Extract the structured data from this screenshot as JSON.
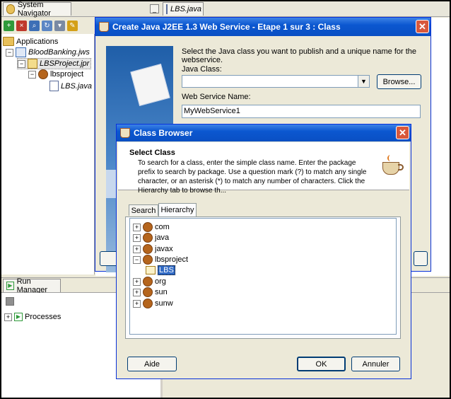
{
  "ide": {
    "tabs": {
      "navigator": "System Navigator",
      "editor": "LBS.java"
    },
    "navigator": {
      "root": "Applications",
      "workspace": "BloodBanking.jws",
      "project": "LBSProject.jpr",
      "package": "lbsproject",
      "file": "LBS.java"
    },
    "run_manager": {
      "tab": "Run Manager",
      "processes": "Processes"
    }
  },
  "wizard": {
    "title": "Create Java J2EE 1.3 Web Service - Etape 1 sur 3 : Class",
    "instruction": "Select the Java class you want to publish and a unique name for the webservice.",
    "java_class_label": "Java Class:",
    "java_class_value": "",
    "browse_label": "Browse...",
    "ws_name_label": "Web Service Name:",
    "ws_name_value": "MyWebService1",
    "close_glyph": "✕"
  },
  "class_browser": {
    "title": "Class Browser",
    "heading": "Select Class",
    "description": "To search for a class, enter the simple class name. Enter the package prefix to search by package. Use a question mark (?) to match any single character, or an asterisk (*) to match any number of characters. Click the Hierarchy tab to browse th...",
    "tabs": [
      "Search",
      "Hierarchy"
    ],
    "active_tab": "Hierarchy",
    "tree": [
      {
        "label": "com",
        "expanded": false
      },
      {
        "label": "java",
        "expanded": false
      },
      {
        "label": "javax",
        "expanded": false
      },
      {
        "label": "lbsproject",
        "expanded": true
      },
      {
        "label": "LBS",
        "child": true,
        "selected": true
      },
      {
        "label": "org",
        "expanded": false
      },
      {
        "label": "sun",
        "expanded": false
      },
      {
        "label": "sunw",
        "expanded": false
      }
    ],
    "help_label": "Aide",
    "ok_label": "OK",
    "cancel_label": "Annuler",
    "close_glyph": "✕"
  },
  "colors": {
    "titlebar": "#0b57d0",
    "selection": "#316ac5",
    "dialog_bg": "#ece9d8"
  }
}
